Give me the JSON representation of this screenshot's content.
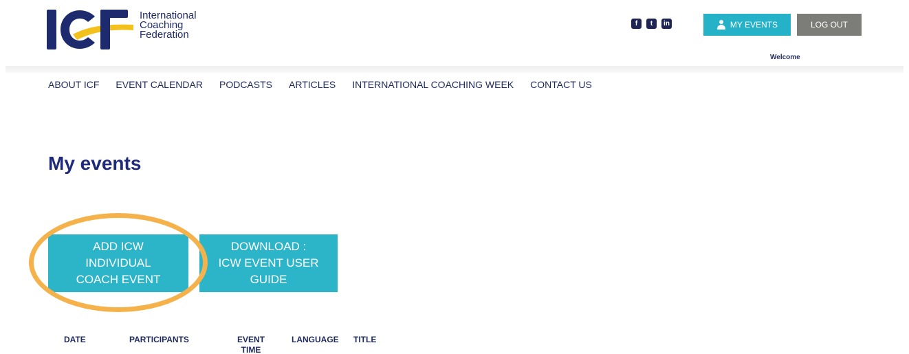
{
  "brand": {
    "logo_letters": "ICF",
    "name_lines": [
      "International",
      "Coaching",
      "Federation"
    ],
    "colors": {
      "navy": "#1e2a6e",
      "yellow": "#f3c11b",
      "teal": "#25b2c8",
      "gray": "#7c7c78",
      "ring": "#f5b24b"
    }
  },
  "social": [
    {
      "icon": "facebook-icon",
      "glyph": "f"
    },
    {
      "icon": "twitter-icon",
      "glyph": "t"
    },
    {
      "icon": "linkedin-icon",
      "glyph": "in"
    }
  ],
  "header": {
    "my_events_label": "MY EVENTS",
    "logout_label": "LOG OUT",
    "welcome": "Welcome"
  },
  "nav": {
    "items": [
      {
        "label": "ABOUT ICF"
      },
      {
        "label": "EVENT CALENDAR"
      },
      {
        "label": "PODCASTS"
      },
      {
        "label": "ARTICLES"
      },
      {
        "label": "INTERNATIONAL COACHING WEEK"
      },
      {
        "label": "CONTACT US"
      }
    ]
  },
  "main": {
    "title": "My events",
    "add_button": "ADD ICW\nINDIVIDUAL\nCOACH EVENT",
    "download_button": "DOWNLOAD :\nICW EVENT USER\nGUIDE"
  },
  "table": {
    "columns": [
      "DATE",
      "PARTICIPANTS",
      "EVENT\nTIME",
      "LANGUAGE",
      "TITLE"
    ]
  }
}
